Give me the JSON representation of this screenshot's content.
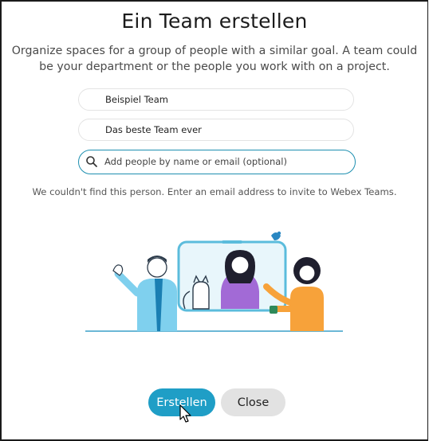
{
  "dialog": {
    "title": "Ein Team erstellen",
    "subtitle": "Organize spaces for a group of people with a similar goal. A team could be your department or the people you work with on a project.",
    "team_name_value": "Beispiel Team",
    "team_description_value": "Das beste Team ever",
    "add_people_placeholder": "Add people by name or email (optional)",
    "hint": "We couldn't find this person. Enter an email address to invite to Webex Teams.",
    "create_button": "Erstellen",
    "close_button": "Close"
  },
  "colors": {
    "accent": "#1f9ec6",
    "search_border": "#1d8fb0",
    "close_button_bg": "#e2e2e2"
  },
  "icons": {
    "search": "search-icon",
    "cursor": "mouse-pointer-icon"
  }
}
